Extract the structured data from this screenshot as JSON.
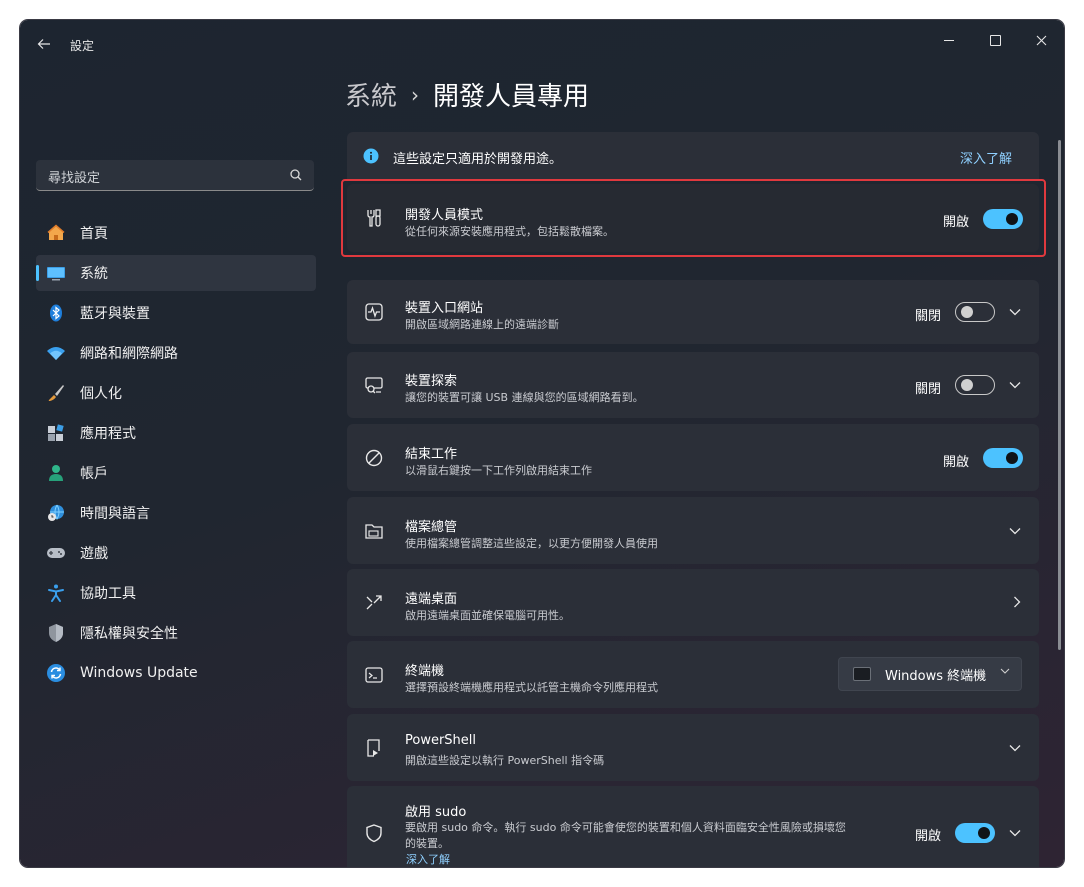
{
  "window": {
    "title": "設定",
    "back_icon": "arrow-left-icon",
    "minimize_icon": "minimize-icon",
    "maximize_icon": "maximize-icon",
    "close_icon": "close-icon"
  },
  "search": {
    "placeholder": "尋找設定",
    "icon": "search-icon"
  },
  "sidebar": {
    "items": [
      {
        "label": "首頁",
        "icon": "home-icon",
        "selected": false
      },
      {
        "label": "系統",
        "icon": "monitor-icon",
        "selected": true
      },
      {
        "label": "藍牙與裝置",
        "icon": "bluetooth-icon",
        "selected": false
      },
      {
        "label": "網路和網際網路",
        "icon": "wifi-icon",
        "selected": false
      },
      {
        "label": "個人化",
        "icon": "brush-icon",
        "selected": false
      },
      {
        "label": "應用程式",
        "icon": "apps-icon",
        "selected": false
      },
      {
        "label": "帳戶",
        "icon": "person-icon",
        "selected": false
      },
      {
        "label": "時間與語言",
        "icon": "globe-clock-icon",
        "selected": false
      },
      {
        "label": "遊戲",
        "icon": "gamepad-icon",
        "selected": false
      },
      {
        "label": "協助工具",
        "icon": "accessibility-icon",
        "selected": false
      },
      {
        "label": "隱私權與安全性",
        "icon": "shield-icon",
        "selected": false
      },
      {
        "label": "Windows Update",
        "icon": "update-icon",
        "selected": false
      }
    ]
  },
  "header": {
    "parent": "系統",
    "separator": "›",
    "current": "開發人員專用"
  },
  "info": {
    "text": "這些設定只適用於開發用途。",
    "link": "深入了解",
    "icon": "info-icon"
  },
  "cards": [
    {
      "title": "開發人員模式",
      "desc": "從任何來源安裝應用程式，包括鬆散檔案。",
      "icon": "tools-icon",
      "toggle_label": "開啟",
      "toggle_on": true
    },
    {
      "title": "裝置入口網站",
      "desc": "開啟區域網路連線上的遠端診斷",
      "icon": "pulse-icon",
      "toggle_label": "關閉",
      "toggle_on": false
    },
    {
      "title": "裝置探索",
      "desc": "讓您的裝置可讓 USB 連線與您的區域網路看到。",
      "icon": "device-search-icon",
      "toggle_label": "關閉",
      "toggle_on": false
    },
    {
      "title": "結束工作",
      "desc": "以滑鼠右鍵按一下工作列啟用結束工作",
      "icon": "block-icon",
      "toggle_label": "開啟",
      "toggle_on": true
    },
    {
      "title": "檔案總管",
      "desc": "使用檔案總管調整這些設定，以更方便開發人員使用",
      "icon": "folder-icon"
    },
    {
      "title": "遠端桌面",
      "desc": "啟用遠端桌面並確保電腦可用性。",
      "icon": "remote-desktop-icon"
    },
    {
      "title": "終端機",
      "desc": "選擇預設終端機應用程式以託管主機命令列應用程式",
      "icon": "terminal-icon",
      "dropdown_value": "Windows 終端機"
    },
    {
      "title": "PowerShell",
      "desc": "開啟這些設定以執行 PowerShell 指令碼",
      "icon": "powershell-icon"
    },
    {
      "title": "啟用 sudo",
      "desc_line1": "要啟用 sudo 命令。執行 sudo 命令可能會使您的裝置和個人資料面臨安全性風險或損壞您",
      "desc_line2": "的裝置。",
      "link": "深入了解",
      "icon": "shield-outline-icon",
      "toggle_label": "開啟",
      "toggle_on": true
    }
  ],
  "colors": {
    "accent": "#4cc2ff",
    "highlight": "#e0393e",
    "card": "#2b2f38"
  }
}
